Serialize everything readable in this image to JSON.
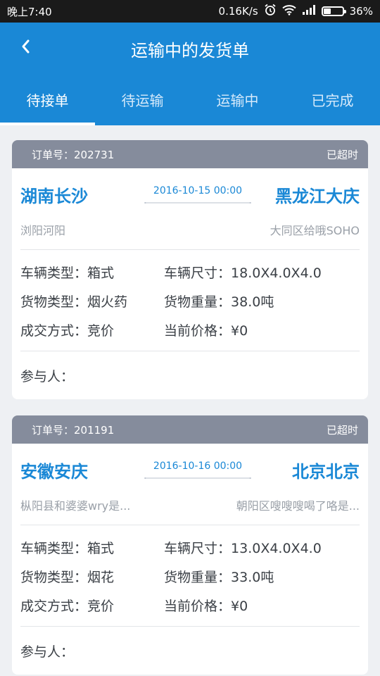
{
  "status_bar": {
    "time": "晚上7:40",
    "speed": "0.16K/s",
    "battery": "36%",
    "battery_level": 0.36
  },
  "header": {
    "title": "运输中的发货单"
  },
  "tabs": [
    {
      "label": "待接单",
      "active": true
    },
    {
      "label": "待运输",
      "active": false
    },
    {
      "label": "运输中",
      "active": false
    },
    {
      "label": "已完成",
      "active": false
    }
  ],
  "labels": {
    "vehicle_type": "车辆类型：",
    "vehicle_size": "车辆尺寸：",
    "cargo_type": "货物类型：",
    "cargo_weight": "货物重量：",
    "deal_method": "成交方式：",
    "current_price": "当前价格：",
    "participants": "参与人："
  },
  "orders": [
    {
      "order_label": "订单号：202731",
      "status": "已超时",
      "from_city": "湖南长沙",
      "to_city": "黑龙江大庆",
      "date": "2016-10-15 00:00",
      "from_addr": "浏阳河阳",
      "to_addr": "大同区给哦SOHO",
      "vehicle_type": "箱式",
      "vehicle_size": "18.0X4.0X4.0",
      "cargo_type": "烟火药",
      "cargo_weight": "38.0吨",
      "deal_method": "竞价",
      "current_price": "¥0",
      "participants": ""
    },
    {
      "order_label": "订单号：201191",
      "status": "已超时",
      "from_city": "安徽安庆",
      "to_city": "北京北京",
      "date": "2016-10-16 00:00",
      "from_addr": "枞阳县和婆婆wry是...",
      "to_addr": "朝阳区嗖嗖嗖喝了咯是...",
      "vehicle_type": "箱式",
      "vehicle_size": "13.0X4.0X4.0",
      "cargo_type": "烟花",
      "cargo_weight": "33.0吨",
      "deal_method": "竞价",
      "current_price": "¥0",
      "participants": ""
    }
  ],
  "colors": {
    "primary": "#1a88d6",
    "card_header": "#858c9c",
    "background": "#eef0f3",
    "muted_text": "#9aa0a8"
  },
  "icons": {
    "back": "chevron-left-icon",
    "alarm": "alarm-clock-icon",
    "wifi": "wifi-icon",
    "signal": "signal-icon",
    "battery": "battery-icon"
  }
}
